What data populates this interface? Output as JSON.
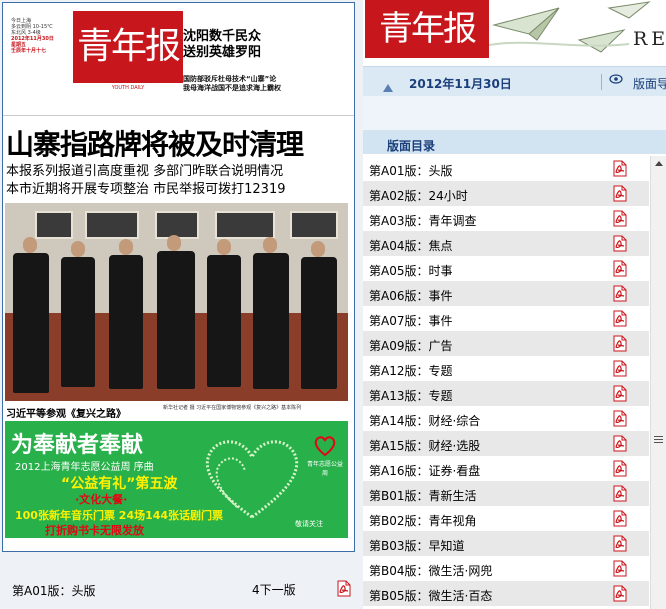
{
  "paper": {
    "masthead": {
      "logo": "青年报",
      "logo_en": "YOUTH DAILY",
      "date_lines": [
        "今日上海",
        "多云到阴 10-15℃",
        "东北风 3-4级",
        "2012年11月30日",
        "星期五",
        "壬辰年十月十七"
      ],
      "headline_right_1": "沈阳数千民众",
      "headline_right_2": "送别英雄罗阳",
      "headline_right_3": "国防部驳斥杜母技术“山寨”论",
      "headline_right_4": "我母海洋战国不是追求海上霸权"
    },
    "lead_title": "山寨指路牌将被及时清理",
    "lead_sub1": "本报系列报道引高度重视  多部门昨联合说明情况",
    "lead_sub2": "本市近期将开展专项整治  市民举报可拨打12319",
    "photo_caption": "习近平等参观《复兴之路》",
    "photo_caption_small": "新华社记者 摄 习近平在国家博物馆参观《复兴之路》基本陈列",
    "ad": {
      "line1": "为奉献者奉献",
      "line2": "2012上海青年志愿公益周  序曲",
      "line3": "“公益有礼”第五波",
      "line4": "·文化大餐·",
      "line5": "100张新年音乐门票  24场144张话剧门票",
      "line6": "打折购书卡无限发放",
      "logo_text": "青年志愿公益周",
      "follow": "敬请关注"
    }
  },
  "footer": {
    "page_label": "第A01版：头版",
    "next_label": "4下一版"
  },
  "banner": {
    "logo": "青年报",
    "partial_text": "RE"
  },
  "date_bar": {
    "date": "2012年11月30日",
    "version_link": "版面导航"
  },
  "toc": {
    "title": "版面目录",
    "items": [
      "第A01版：头版",
      "第A02版：24小时",
      "第A03版：青年调查",
      "第A04版：焦点",
      "第A05版：时事",
      "第A06版：事件",
      "第A07版：事件",
      "第A09版：广告",
      "第A12版：专题",
      "第A13版：专题",
      "第A14版：财经·综合",
      "第A15版：财经·选股",
      "第A16版：证券·看盘",
      "第B01版：青新生活",
      "第B02版：青年视角",
      "第B03版：早知道",
      "第B04版：微生活·网兜",
      "第B05版：微生活·百态"
    ]
  },
  "colors": {
    "brand_red": "#c8161d",
    "nav_blue": "#1a3f7a",
    "date_bar_bg": "#dbe9f5",
    "row_alt": "#e8e8e8"
  },
  "icons": [
    "pdf-icon",
    "eye-icon",
    "scroll-up-icon"
  ]
}
